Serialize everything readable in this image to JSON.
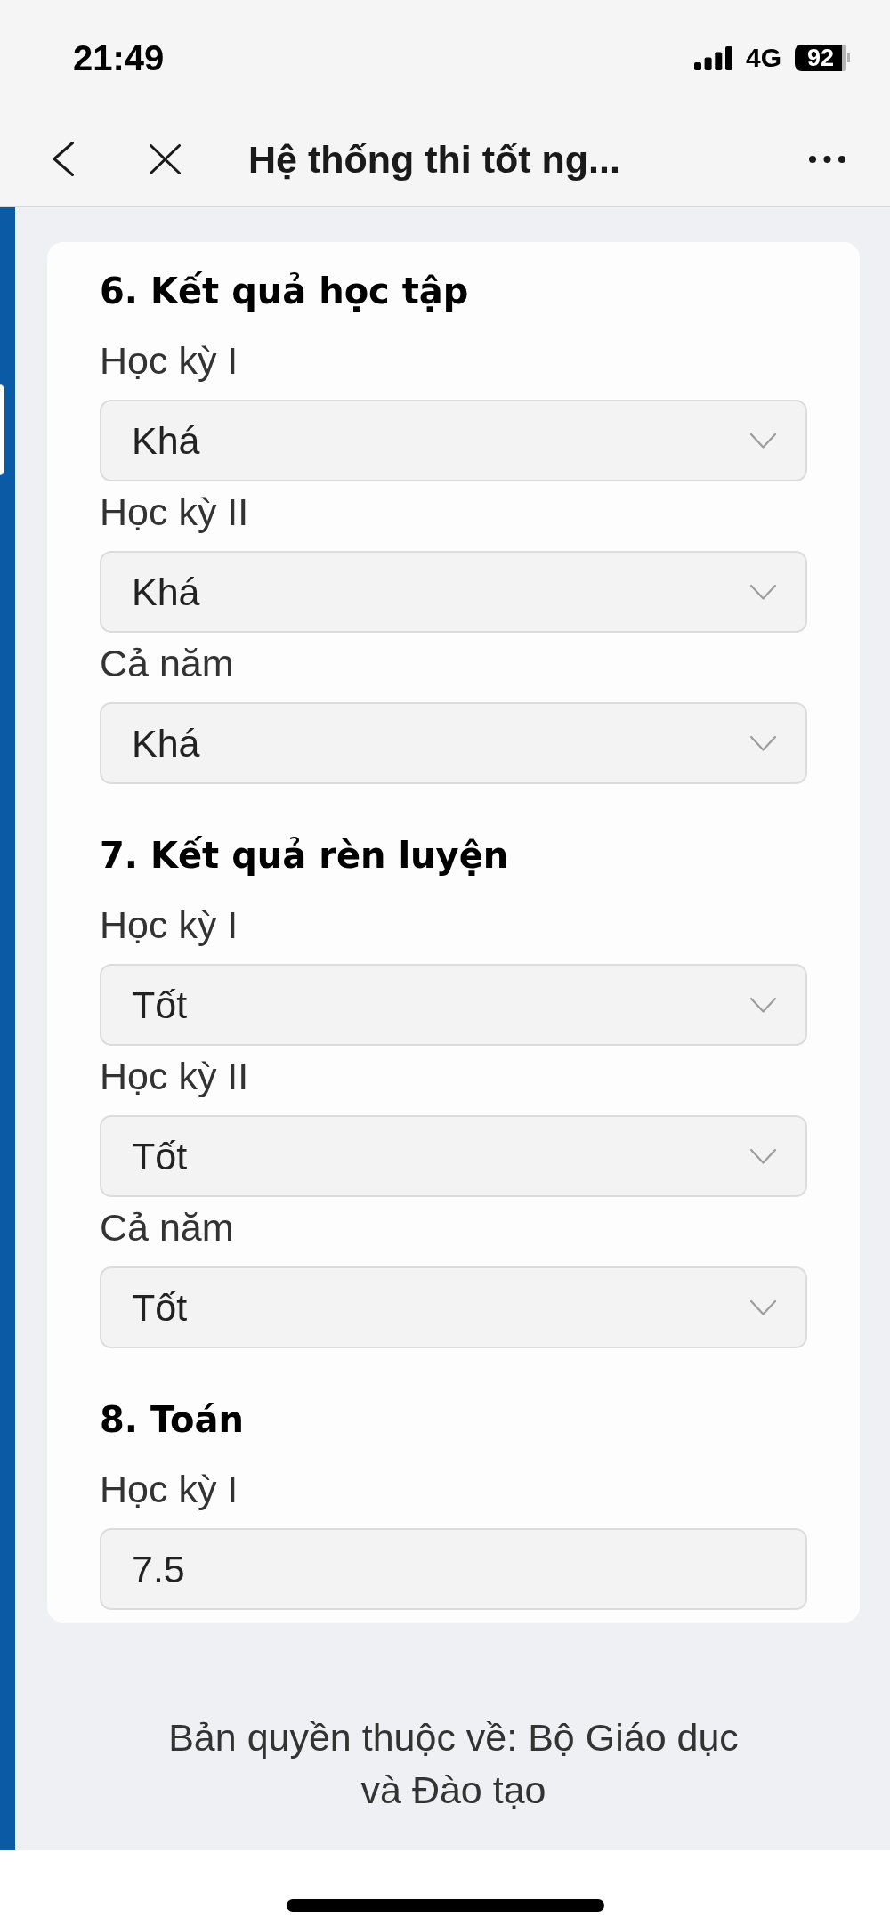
{
  "status_bar": {
    "time": "21:49",
    "network": "4G",
    "battery": "92"
  },
  "nav_bar": {
    "title": "Hệ thống thi tốt ng..."
  },
  "sections": [
    {
      "title": "6. Kết quả học tập",
      "fields": [
        {
          "kind": "select",
          "label": "Học kỳ I",
          "value": "Khá"
        },
        {
          "kind": "select",
          "label": "Học kỳ II",
          "value": "Khá"
        },
        {
          "kind": "select",
          "label": "Cả năm",
          "value": "Khá"
        }
      ]
    },
    {
      "title": "7. Kết quả rèn luyện",
      "fields": [
        {
          "kind": "select",
          "label": "Học kỳ I",
          "value": "Tốt"
        },
        {
          "kind": "select",
          "label": "Học kỳ II",
          "value": "Tốt"
        },
        {
          "kind": "select",
          "label": "Cả năm",
          "value": "Tốt"
        }
      ]
    },
    {
      "title": "8. Toán",
      "fields": [
        {
          "kind": "text",
          "label": "Học kỳ I",
          "value": "7.5"
        }
      ]
    }
  ],
  "footer": {
    "text": "Bản quyền thuộc về: Bộ Giáo dục và Đào tạo"
  }
}
